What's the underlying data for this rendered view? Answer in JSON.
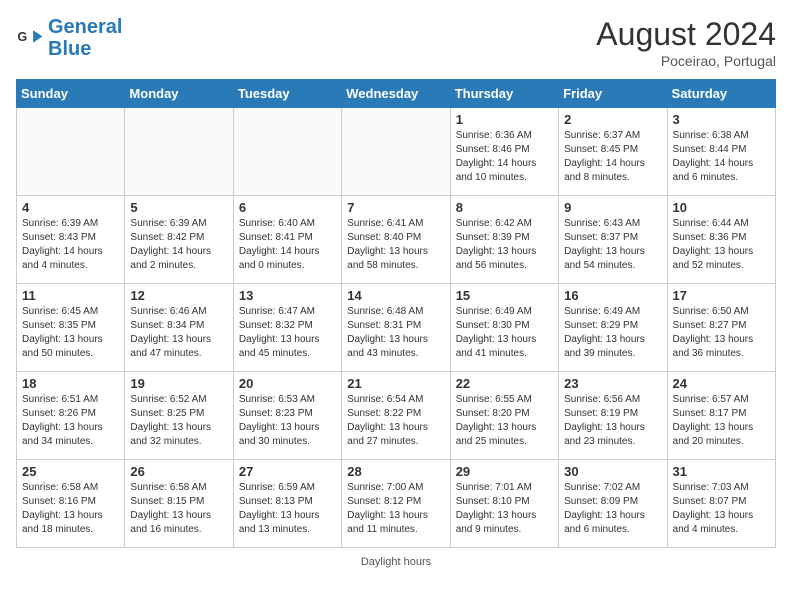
{
  "header": {
    "logo_general": "General",
    "logo_blue": "Blue",
    "month_year": "August 2024",
    "location": "Poceirao, Portugal"
  },
  "days_of_week": [
    "Sunday",
    "Monday",
    "Tuesday",
    "Wednesday",
    "Thursday",
    "Friday",
    "Saturday"
  ],
  "weeks": [
    [
      {
        "day": "",
        "info": ""
      },
      {
        "day": "",
        "info": ""
      },
      {
        "day": "",
        "info": ""
      },
      {
        "day": "",
        "info": ""
      },
      {
        "day": "1",
        "info": "Sunrise: 6:36 AM\nSunset: 8:46 PM\nDaylight: 14 hours\nand 10 minutes."
      },
      {
        "day": "2",
        "info": "Sunrise: 6:37 AM\nSunset: 8:45 PM\nDaylight: 14 hours\nand 8 minutes."
      },
      {
        "day": "3",
        "info": "Sunrise: 6:38 AM\nSunset: 8:44 PM\nDaylight: 14 hours\nand 6 minutes."
      }
    ],
    [
      {
        "day": "4",
        "info": "Sunrise: 6:39 AM\nSunset: 8:43 PM\nDaylight: 14 hours\nand 4 minutes."
      },
      {
        "day": "5",
        "info": "Sunrise: 6:39 AM\nSunset: 8:42 PM\nDaylight: 14 hours\nand 2 minutes."
      },
      {
        "day": "6",
        "info": "Sunrise: 6:40 AM\nSunset: 8:41 PM\nDaylight: 14 hours\nand 0 minutes."
      },
      {
        "day": "7",
        "info": "Sunrise: 6:41 AM\nSunset: 8:40 PM\nDaylight: 13 hours\nand 58 minutes."
      },
      {
        "day": "8",
        "info": "Sunrise: 6:42 AM\nSunset: 8:39 PM\nDaylight: 13 hours\nand 56 minutes."
      },
      {
        "day": "9",
        "info": "Sunrise: 6:43 AM\nSunset: 8:37 PM\nDaylight: 13 hours\nand 54 minutes."
      },
      {
        "day": "10",
        "info": "Sunrise: 6:44 AM\nSunset: 8:36 PM\nDaylight: 13 hours\nand 52 minutes."
      }
    ],
    [
      {
        "day": "11",
        "info": "Sunrise: 6:45 AM\nSunset: 8:35 PM\nDaylight: 13 hours\nand 50 minutes."
      },
      {
        "day": "12",
        "info": "Sunrise: 6:46 AM\nSunset: 8:34 PM\nDaylight: 13 hours\nand 47 minutes."
      },
      {
        "day": "13",
        "info": "Sunrise: 6:47 AM\nSunset: 8:32 PM\nDaylight: 13 hours\nand 45 minutes."
      },
      {
        "day": "14",
        "info": "Sunrise: 6:48 AM\nSunset: 8:31 PM\nDaylight: 13 hours\nand 43 minutes."
      },
      {
        "day": "15",
        "info": "Sunrise: 6:49 AM\nSunset: 8:30 PM\nDaylight: 13 hours\nand 41 minutes."
      },
      {
        "day": "16",
        "info": "Sunrise: 6:49 AM\nSunset: 8:29 PM\nDaylight: 13 hours\nand 39 minutes."
      },
      {
        "day": "17",
        "info": "Sunrise: 6:50 AM\nSunset: 8:27 PM\nDaylight: 13 hours\nand 36 minutes."
      }
    ],
    [
      {
        "day": "18",
        "info": "Sunrise: 6:51 AM\nSunset: 8:26 PM\nDaylight: 13 hours\nand 34 minutes."
      },
      {
        "day": "19",
        "info": "Sunrise: 6:52 AM\nSunset: 8:25 PM\nDaylight: 13 hours\nand 32 minutes."
      },
      {
        "day": "20",
        "info": "Sunrise: 6:53 AM\nSunset: 8:23 PM\nDaylight: 13 hours\nand 30 minutes."
      },
      {
        "day": "21",
        "info": "Sunrise: 6:54 AM\nSunset: 8:22 PM\nDaylight: 13 hours\nand 27 minutes."
      },
      {
        "day": "22",
        "info": "Sunrise: 6:55 AM\nSunset: 8:20 PM\nDaylight: 13 hours\nand 25 minutes."
      },
      {
        "day": "23",
        "info": "Sunrise: 6:56 AM\nSunset: 8:19 PM\nDaylight: 13 hours\nand 23 minutes."
      },
      {
        "day": "24",
        "info": "Sunrise: 6:57 AM\nSunset: 8:17 PM\nDaylight: 13 hours\nand 20 minutes."
      }
    ],
    [
      {
        "day": "25",
        "info": "Sunrise: 6:58 AM\nSunset: 8:16 PM\nDaylight: 13 hours\nand 18 minutes."
      },
      {
        "day": "26",
        "info": "Sunrise: 6:58 AM\nSunset: 8:15 PM\nDaylight: 13 hours\nand 16 minutes."
      },
      {
        "day": "27",
        "info": "Sunrise: 6:59 AM\nSunset: 8:13 PM\nDaylight: 13 hours\nand 13 minutes."
      },
      {
        "day": "28",
        "info": "Sunrise: 7:00 AM\nSunset: 8:12 PM\nDaylight: 13 hours\nand 11 minutes."
      },
      {
        "day": "29",
        "info": "Sunrise: 7:01 AM\nSunset: 8:10 PM\nDaylight: 13 hours\nand 9 minutes."
      },
      {
        "day": "30",
        "info": "Sunrise: 7:02 AM\nSunset: 8:09 PM\nDaylight: 13 hours\nand 6 minutes."
      },
      {
        "day": "31",
        "info": "Sunrise: 7:03 AM\nSunset: 8:07 PM\nDaylight: 13 hours\nand 4 minutes."
      }
    ]
  ],
  "footer": {
    "daylight_label": "Daylight hours"
  }
}
